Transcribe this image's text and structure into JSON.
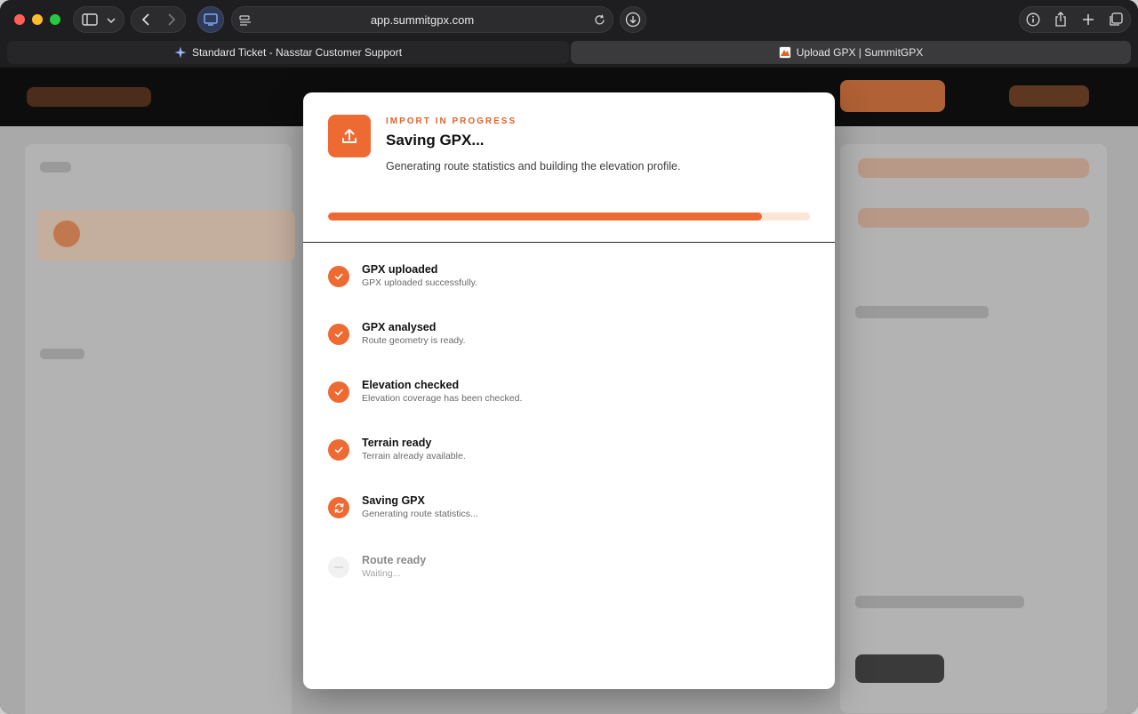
{
  "browser": {
    "url": "app.summitgpx.com",
    "tabs": [
      {
        "label": "Standard Ticket - Nasstar Customer Support"
      },
      {
        "label": "Upload GPX | SummitGPX"
      }
    ]
  },
  "modal": {
    "eyebrow": "IMPORT IN PROGRESS",
    "title": "Saving GPX...",
    "subtitle": "Generating route statistics and building the elevation profile.",
    "progress": 0.9,
    "steps": [
      {
        "title": "GPX uploaded",
        "detail": "GPX uploaded successfully.",
        "status": "done",
        "icon": "check-icon"
      },
      {
        "title": "GPX analysed",
        "detail": "Route geometry is ready.",
        "status": "done",
        "icon": "check-icon"
      },
      {
        "title": "Elevation checked",
        "detail": "Elevation coverage has been checked.",
        "status": "done",
        "icon": "check-icon"
      },
      {
        "title": "Terrain ready",
        "detail": "Terrain already available.",
        "status": "done",
        "icon": "check-icon"
      },
      {
        "title": "Saving GPX",
        "detail": "Generating route statistics...",
        "status": "active",
        "icon": "refresh-icon"
      },
      {
        "title": "Route ready",
        "detail": "Waiting...",
        "status": "waiting",
        "icon": "dash-icon"
      }
    ]
  },
  "colors": {
    "accent": "#ee6a33",
    "progress_track": "#fbe5d6"
  }
}
